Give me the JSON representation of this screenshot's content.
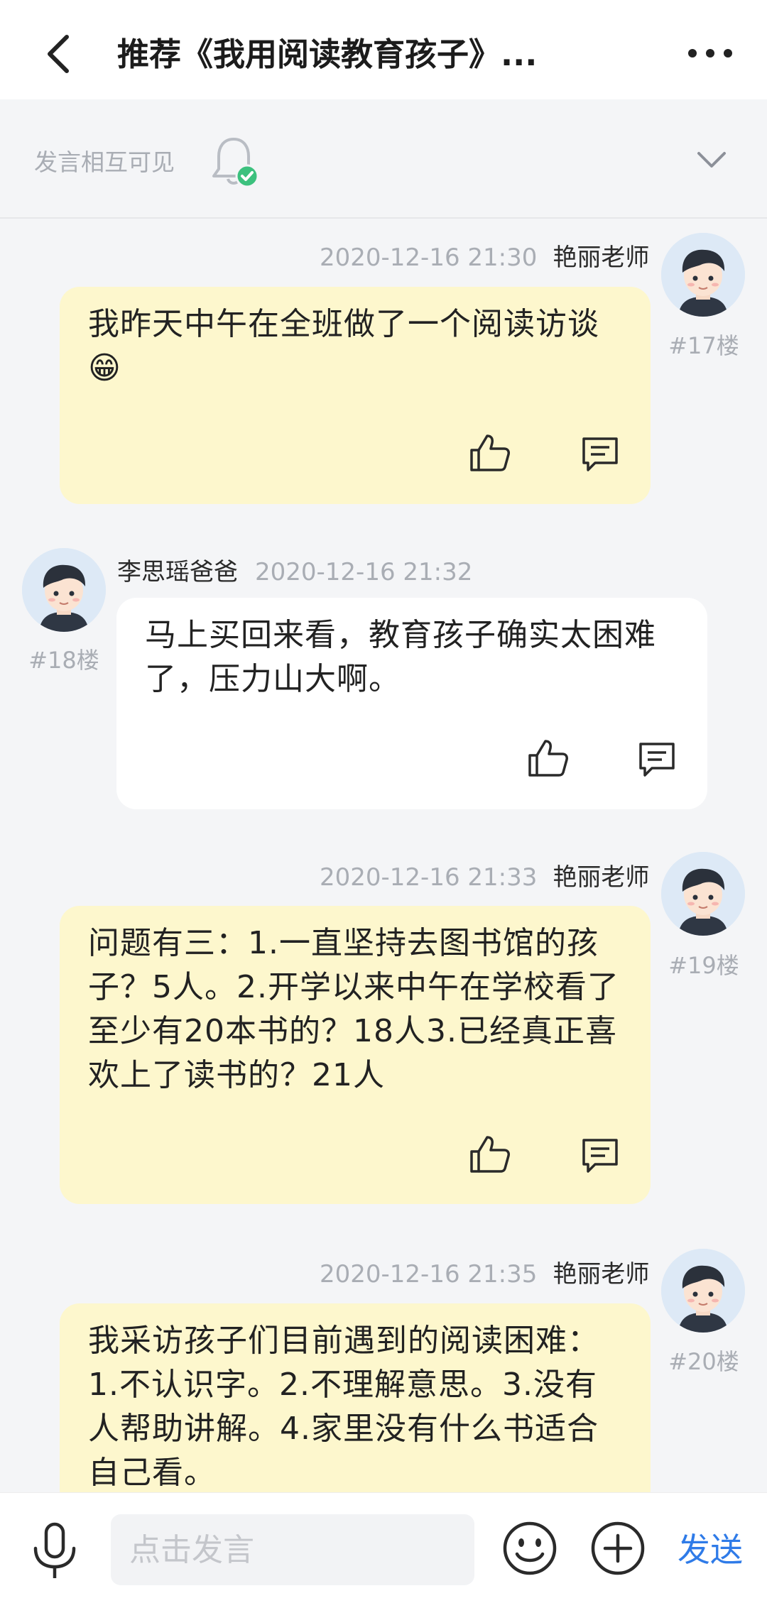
{
  "header": {
    "title": "推荐《我用阅读教育孩子》...",
    "back_icon": "chevron-left-icon",
    "more_icon": "more-dots-icon"
  },
  "visibility_bar": {
    "text": "发言相互可见",
    "bell_icon": "bell-check-icon",
    "collapse_icon": "chevron-down-icon"
  },
  "posts": [
    {
      "author": "艳丽老师",
      "time": "2020-12-16 21:30",
      "floor": "#17楼",
      "text": "我昨天中午在全班做了一个阅读访谈😁",
      "side": "right"
    },
    {
      "author": "李思瑶爸爸",
      "time": "2020-12-16 21:32",
      "floor": "#18楼",
      "text": "马上买回来看，教育孩子确实太困难了，压力山大啊。",
      "side": "left"
    },
    {
      "author": "艳丽老师",
      "time": "2020-12-16 21:33",
      "floor": "#19楼",
      "text": "问题有三：1.一直坚持去图书馆的孩子？5人。2.开学以来中午在学校看了至少有20本书的？18人3.已经真正喜欢上了读书的？21人",
      "side": "right"
    },
    {
      "author": "艳丽老师",
      "time": "2020-12-16 21:35",
      "floor": "#20楼",
      "text": "我采访孩子们目前遇到的阅读困难：1.不认识字。2.不理解意思。3.没有人帮助讲解。4.家里没有什么书适合自己看。",
      "side": "right"
    }
  ],
  "bottom_bar": {
    "input_placeholder": "点击发言",
    "send_label": "发送",
    "mic_icon": "microphone-icon",
    "emoji_icon": "smiley-icon",
    "plus_icon": "plus-circle-icon"
  },
  "colors": {
    "teacher_bubble": "#fdf7cd",
    "parent_bubble": "#ffffff",
    "accent": "#2f7be8",
    "page_bg": "#f4f5f7"
  }
}
